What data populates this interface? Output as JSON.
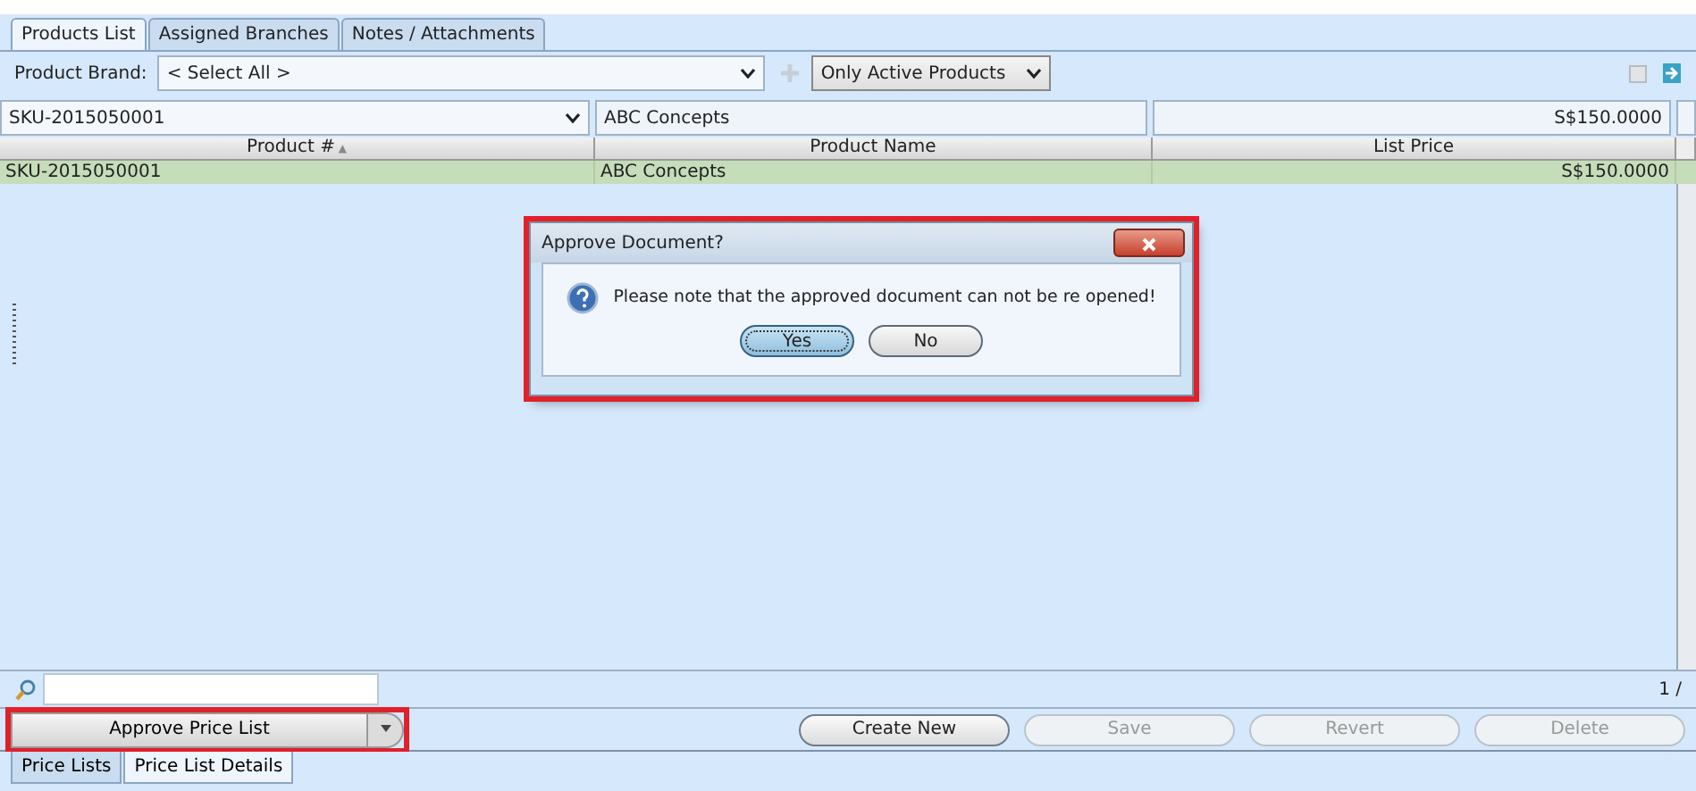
{
  "top_tabs": [
    {
      "label": "Products List",
      "selected": true
    },
    {
      "label": "Assigned Branches",
      "selected": false
    },
    {
      "label": "Notes / Attachments",
      "selected": false
    }
  ],
  "brand_filter": {
    "label": "Product Brand:",
    "value": "< Select All >"
  },
  "status_filter": {
    "value": "Only Active Products"
  },
  "table": {
    "filters": [
      "SKU-2015050001",
      "ABC Concepts",
      "S$150.0000"
    ],
    "columns": [
      {
        "label": "Product #",
        "sort_indicator": "▲"
      },
      {
        "label": "Product Name"
      },
      {
        "label": "List Price"
      }
    ],
    "rows": [
      {
        "cells": [
          "SKU-2015050001",
          "ABC Concepts",
          "S$150.0000"
        ],
        "selected": true
      }
    ]
  },
  "pager": "1 /",
  "approve_button": {
    "label": "Approve Price List",
    "highlighted": true
  },
  "buttons": [
    {
      "label": "Create New",
      "disabled": false
    },
    {
      "label": "Save",
      "disabled": true
    },
    {
      "label": "Revert",
      "disabled": true
    },
    {
      "label": "Delete",
      "disabled": true
    }
  ],
  "bottom_tabs": [
    {
      "label": "Price Lists",
      "selected": false
    },
    {
      "label": "Price List Details",
      "selected": true
    }
  ],
  "dialog": {
    "title": "Approve Document?",
    "message": "Please note that the approved document can not be re opened!",
    "highlighted": true,
    "buttons": [
      {
        "label": "Yes",
        "focused": true
      },
      {
        "label": "No",
        "focused": false
      }
    ]
  }
}
